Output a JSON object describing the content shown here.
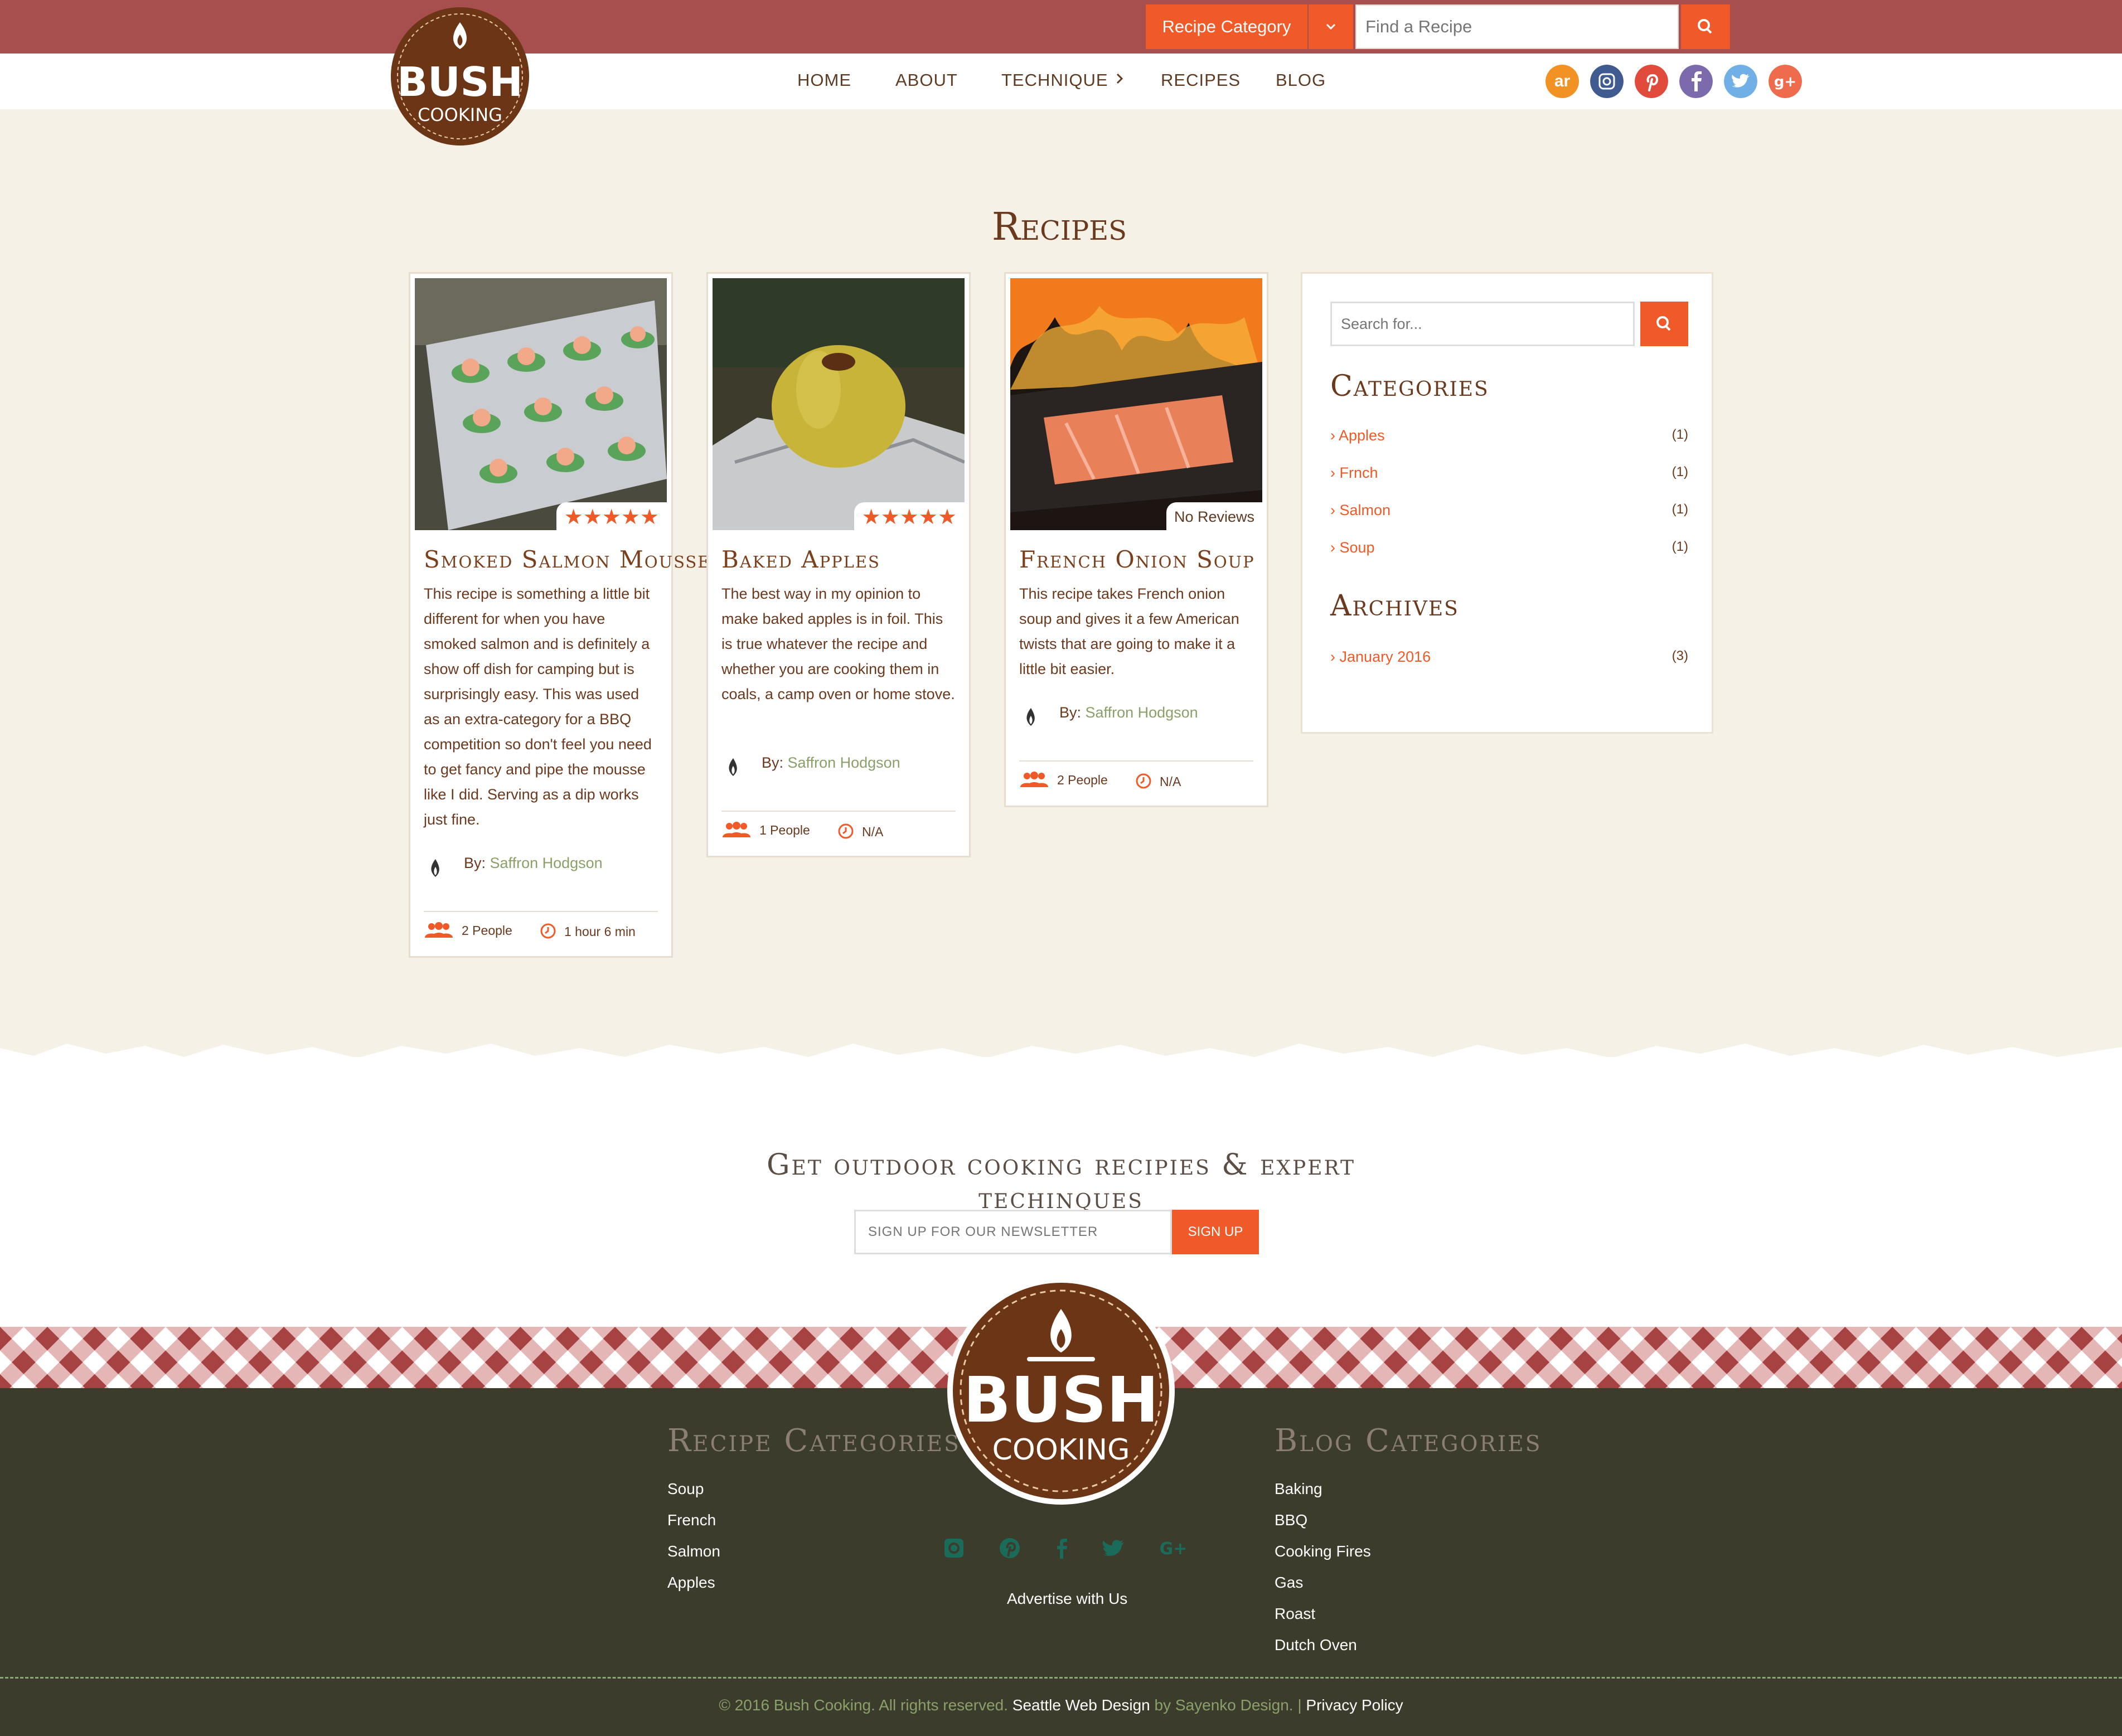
{
  "header": {
    "category_label": "Recipe Category",
    "find_placeholder": "Find a Recipe",
    "logo_top": "BUSH",
    "logo_bottom": "COOKING"
  },
  "nav": {
    "home": "HOME",
    "about": "ABOUT",
    "technique": "TECHNIQUE",
    "recipes": "RECIPES",
    "blog": "BLOG"
  },
  "social": {
    "allrecipes": "ar"
  },
  "page_title": "Recipes",
  "cards": [
    {
      "title": "Smoked Salmon Mousse",
      "rating": "★★★★★",
      "desc": "This recipe is something a little bit different for when you have smoked salmon and is definitely a show off dish for camping but is surprisingly easy. This was used as an extra-category for a BBQ competition so don't feel you need to get fancy and pipe the mousse like I did. Serving as a dip works just fine.",
      "by": "By:",
      "author": "Saffron Hodgson",
      "people": "2 People",
      "time": "1 hour 6 min"
    },
    {
      "title": "Baked Apples",
      "rating": "★★★★★",
      "desc": "The best way in my opinion to make baked apples is in foil. This is true whatever the recipe and whether you are cooking them in coals, a camp oven or home stove.",
      "by": "By:",
      "author": "Saffron Hodgson",
      "people": "1 People",
      "time": "N/A"
    },
    {
      "title": "French Onion Soup",
      "rating": "No Reviews",
      "desc": "This recipe takes French onion soup and gives it a few American twists that are going to make it a little bit easier.",
      "by": "By:",
      "author": "Saffron Hodgson",
      "people": "2 People",
      "time": "N/A"
    }
  ],
  "sidebar": {
    "search_placeholder": "Search for...",
    "categories_title": "Categories",
    "categories": [
      {
        "label": "Apples",
        "count": "(1)"
      },
      {
        "label": "Frnch",
        "count": "(1)"
      },
      {
        "label": "Salmon",
        "count": "(1)"
      },
      {
        "label": "Soup",
        "count": "(1)"
      }
    ],
    "archives_title": "Archives",
    "archives": [
      {
        "label": "January 2016",
        "count": "(3)"
      }
    ]
  },
  "newsletter": {
    "title": "Get outdoor cooking recipies & expert techinques",
    "placeholder": "SIGN UP FOR OUR NEWSLETTER",
    "button": "SIGN UP"
  },
  "footer": {
    "recipe_categories_title": "Recipe Categories",
    "recipe_categories": [
      "Soup",
      "French",
      "Salmon",
      "Apples"
    ],
    "blog_categories_title": "Blog Categories",
    "blog_categories": [
      "Baking",
      "BBQ",
      "Cooking Fires",
      "Gas",
      "Roast",
      "Dutch Oven"
    ],
    "advertise": "Advertise with Us",
    "logo_top": "BUSH",
    "logo_bottom": "COOKING",
    "copyright": "© 2016 Bush Cooking. All rights reserved.",
    "seattle": "Seattle Web Design",
    "by": "by Sayenko Design. |",
    "privacy": "Privacy Policy"
  },
  "colors": {
    "accent": "#ef5a28",
    "topbar": "#a64f4e",
    "cream": "#f6f1e7",
    "brown": "#6b3a1e",
    "footer": "#3c3c2d",
    "green": "#8aa069"
  }
}
